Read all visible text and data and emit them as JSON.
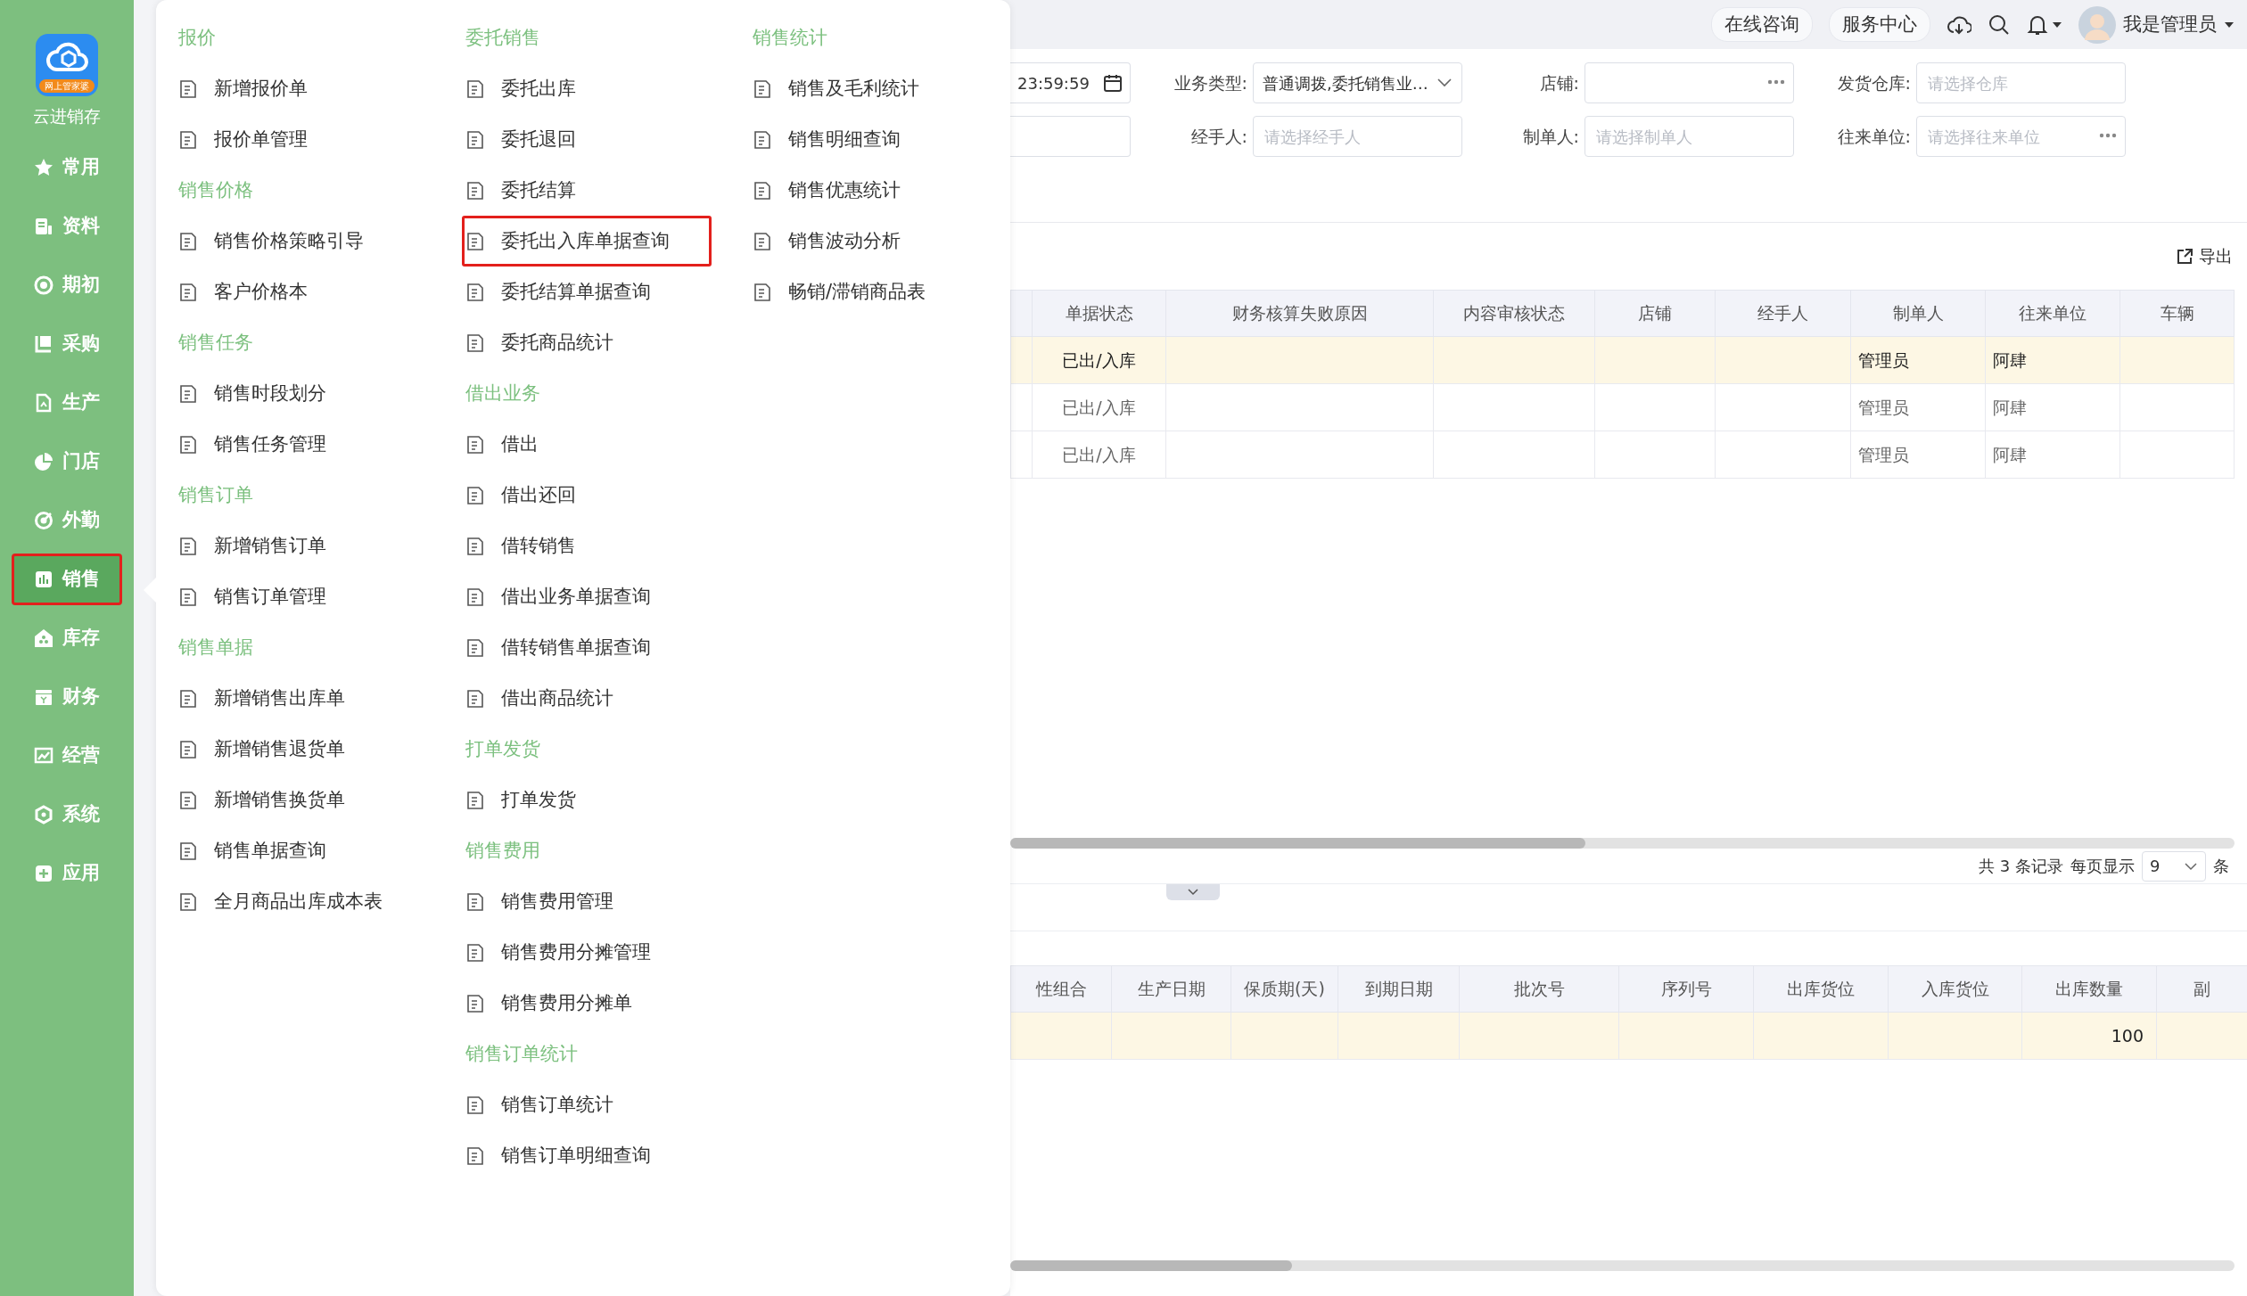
{
  "sidebar": {
    "logo_badge": "网上管家婆",
    "app_name": "云进销存",
    "items": [
      {
        "label": "常用",
        "selected": false
      },
      {
        "label": "资料",
        "selected": false
      },
      {
        "label": "期初",
        "selected": false
      },
      {
        "label": "采购",
        "selected": false
      },
      {
        "label": "生产",
        "selected": false
      },
      {
        "label": "门店",
        "selected": false
      },
      {
        "label": "外勤",
        "selected": false
      },
      {
        "label": "销售",
        "selected": true
      },
      {
        "label": "库存",
        "selected": false
      },
      {
        "label": "财务",
        "selected": false
      },
      {
        "label": "经营",
        "selected": false
      },
      {
        "label": "系统",
        "selected": false
      },
      {
        "label": "应用",
        "selected": false
      }
    ]
  },
  "menu": {
    "columns": [
      [
        {
          "heading": "报价",
          "items": [
            {
              "label": "新增报价单",
              "highlighted": false
            },
            {
              "label": "报价单管理",
              "highlighted": false
            }
          ]
        },
        {
          "heading": "销售价格",
          "items": [
            {
              "label": "销售价格策略引导",
              "highlighted": false
            },
            {
              "label": "客户价格本",
              "highlighted": false
            }
          ]
        },
        {
          "heading": "销售任务",
          "items": [
            {
              "label": "销售时段划分",
              "highlighted": false
            },
            {
              "label": "销售任务管理",
              "highlighted": false
            }
          ]
        },
        {
          "heading": "销售订单",
          "items": [
            {
              "label": "新增销售订单",
              "highlighted": false
            },
            {
              "label": "销售订单管理",
              "highlighted": false
            }
          ]
        },
        {
          "heading": "销售单据",
          "items": [
            {
              "label": "新增销售出库单",
              "highlighted": false
            },
            {
              "label": "新增销售退货单",
              "highlighted": false
            },
            {
              "label": "新增销售换货单",
              "highlighted": false
            },
            {
              "label": "销售单据查询",
              "highlighted": false
            },
            {
              "label": "全月商品出库成本表",
              "highlighted": false
            }
          ]
        }
      ],
      [
        {
          "heading": "委托销售",
          "items": [
            {
              "label": "委托出库",
              "highlighted": false
            },
            {
              "label": "委托退回",
              "highlighted": false
            },
            {
              "label": "委托结算",
              "highlighted": false
            },
            {
              "label": "委托出入库单据查询",
              "highlighted": true
            },
            {
              "label": "委托结算单据查询",
              "highlighted": false
            },
            {
              "label": "委托商品统计",
              "highlighted": false
            }
          ]
        },
        {
          "heading": "借出业务",
          "items": [
            {
              "label": "借出",
              "highlighted": false
            },
            {
              "label": "借出还回",
              "highlighted": false
            },
            {
              "label": "借转销售",
              "highlighted": false
            },
            {
              "label": "借出业务单据查询",
              "highlighted": false
            },
            {
              "label": "借转销售单据查询",
              "highlighted": false
            },
            {
              "label": "借出商品统计",
              "highlighted": false
            }
          ]
        },
        {
          "heading": "打单发货",
          "items": [
            {
              "label": "打单发货",
              "highlighted": false
            }
          ]
        },
        {
          "heading": "销售费用",
          "items": [
            {
              "label": "销售费用管理",
              "highlighted": false
            },
            {
              "label": "销售费用分摊管理",
              "highlighted": false
            },
            {
              "label": "销售费用分摊单",
              "highlighted": false
            }
          ]
        },
        {
          "heading": "销售订单统计",
          "items": [
            {
              "label": "销售订单统计",
              "highlighted": false
            },
            {
              "label": "销售订单明细查询",
              "highlighted": false
            }
          ]
        }
      ],
      [
        {
          "heading": "销售统计",
          "items": [
            {
              "label": "销售及毛利统计",
              "highlighted": false
            },
            {
              "label": "销售明细查询",
              "highlighted": false
            },
            {
              "label": "销售优惠统计",
              "highlighted": false
            },
            {
              "label": "销售波动分析",
              "highlighted": false
            },
            {
              "label": "畅销/滞销商品表",
              "highlighted": false
            }
          ]
        }
      ]
    ]
  },
  "topbar": {
    "buttons": [
      "在线咨询",
      "服务中心"
    ],
    "user": "我是管理员"
  },
  "filters": {
    "date_value": "23:59:59",
    "rows": [
      [
        {
          "label": "业务类型:",
          "value": "普通调拨,委托销售业…",
          "kind": "select"
        },
        {
          "label": "店铺:",
          "kind": "picker"
        },
        {
          "label": "发货仓库:",
          "placeholder": "请选择仓库",
          "kind": "text"
        }
      ],
      [
        {
          "label": "经手人:",
          "placeholder": "请选择经手人",
          "kind": "text"
        },
        {
          "label": "制单人:",
          "placeholder": "请选择制单人",
          "kind": "text"
        },
        {
          "label": "往来单位:",
          "placeholder": "请选择往来单位",
          "kind": "picker"
        }
      ]
    ]
  },
  "orders_table": {
    "export": "导出",
    "columns": [
      "单据状态",
      "财务核算失败原因",
      "内容审核状态",
      "店铺",
      "经手人",
      "制单人",
      "往来单位",
      "车辆"
    ],
    "rows": [
      {
        "selected": true,
        "status": "已出/入库",
        "creator": "管理员",
        "partner": "阿肆"
      },
      {
        "selected": false,
        "status": "已出/入库",
        "creator": "管理员",
        "partner": "阿肆"
      },
      {
        "selected": false,
        "status": "已出/入库",
        "creator": "管理员",
        "partner": "阿肆"
      }
    ]
  },
  "pagination": {
    "total": "共 3 条记录",
    "per_page_label": "每页显示",
    "per_page": "9",
    "unit": "条"
  },
  "detail_table": {
    "columns": [
      "性组合",
      "生产日期",
      "保质期(天)",
      "到期日期",
      "批次号",
      "序列号",
      "出库货位",
      "入库货位",
      "出库数量",
      "副"
    ],
    "rows": [
      {
        "selected": true,
        "out_qty": "100"
      }
    ]
  }
}
